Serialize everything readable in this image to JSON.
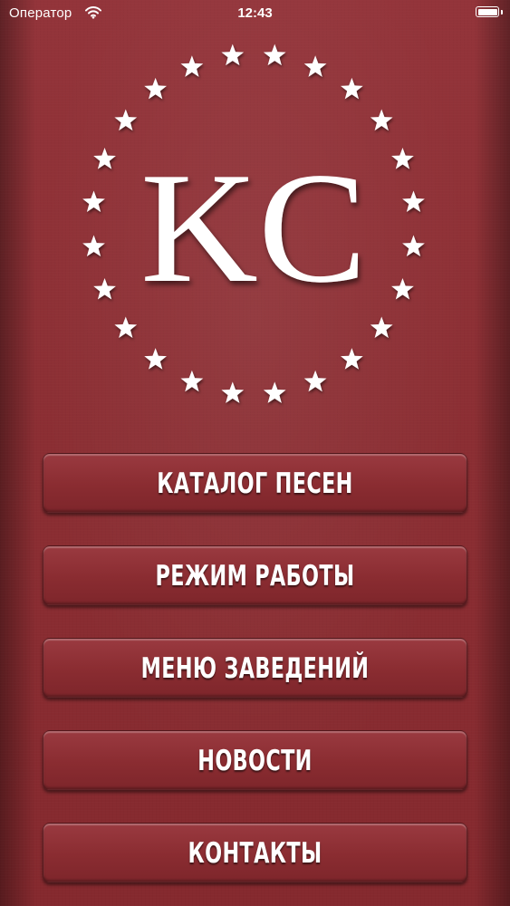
{
  "status_bar": {
    "carrier": "Оператор",
    "time": "12:43",
    "wifi_icon": "wifi-icon",
    "battery_icon": "battery-icon",
    "battery_level": 1.0
  },
  "logo": {
    "letters": "KC",
    "star_count": 24,
    "star_icon": "star-icon",
    "letter_color": "#ffffff"
  },
  "menu": {
    "items": [
      {
        "label": "КАТАЛОГ ПЕСЕН"
      },
      {
        "label": "РЕЖИМ РАБОТЫ"
      },
      {
        "label": "МЕНЮ ЗАВЕДЕНИЙ"
      },
      {
        "label": "НОВОСТИ"
      },
      {
        "label": "КОНТАКТЫ"
      }
    ]
  },
  "colors": {
    "background": "#8c2f33",
    "button": "#8e3035",
    "text": "#ffffff"
  }
}
